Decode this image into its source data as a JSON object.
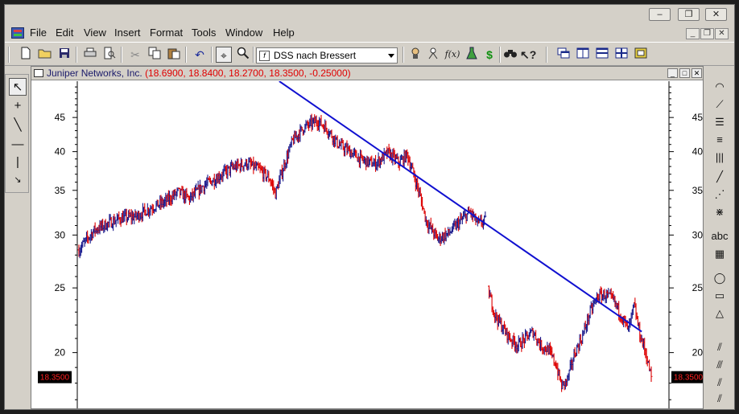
{
  "window": {
    "minimize_glyph": "–",
    "maximize_glyph": "❐",
    "close_glyph": "✕"
  },
  "menu": {
    "items": [
      "File",
      "Edit",
      "View",
      "Insert",
      "Format",
      "Tools",
      "Window",
      "Help"
    ],
    "mdi_minimize": "_",
    "mdi_restore": "❐",
    "mdi_close": "✕"
  },
  "toolbar": {
    "study_select_value": "DSS nach Bressert",
    "study_select_icon": "f",
    "study_dollar": "$",
    "study_fx": "f(x)",
    "icons": [
      "new-file-icon",
      "open-folder-icon",
      "save-icon",
      "print-icon",
      "print-preview-icon",
      "cut-icon",
      "copy-icon",
      "paste-icon",
      "undo-icon",
      "crosshair-icon",
      "zoom-icon"
    ]
  },
  "left_palette": {
    "icons": [
      "pointer-icon",
      "crosshair-icon",
      "trendline-icon",
      "horizontal-line-icon",
      "vertical-line-icon",
      "arrow-icon"
    ]
  },
  "right_palette": {
    "icons": [
      "speed-arc-icon",
      "speed-fan-icon",
      "fibonacci-retracement-icon",
      "fibonacci-time-icon",
      "cycle-lines-icon",
      "gann-line-icon",
      "gann-fan-icon",
      "gann-grid-icon",
      "text-label-icon",
      "table-icon",
      "ellipse-icon",
      "rectangle-icon",
      "triangle-icon",
      "andrews-pitchfork-icon",
      "parallel-lines-icon",
      "regression-channel-icon"
    ],
    "text_tool_label": "abc"
  },
  "chart_window": {
    "symbol": "Juniper Networks, Inc.",
    "ohlc": "(18.6900, 18.8400, 18.2700, 18.3500, -0.25000)",
    "minimize_glyph": "_",
    "restore_glyph": "□",
    "close_glyph": "✕"
  },
  "chart_data": {
    "type": "bar",
    "subtype": "ohlc-price-chart",
    "title": "Juniper Networks, Inc.",
    "scale": "log",
    "ylim": [
      16.5,
      51
    ],
    "y_ticks": [
      45,
      40,
      35,
      30,
      25,
      20
    ],
    "last_price_label": "18.3500",
    "last_price": 18.35,
    "grid": false,
    "colors": {
      "up_bar": "#1a1a8c",
      "down_bar": "#dd0000",
      "trendline": "#1010d0",
      "last_price_bg": "#000000",
      "last_price_text": "#ff2020"
    },
    "x_range": [
      0,
      300
    ],
    "trendline": {
      "x0": 105,
      "y0": 51,
      "x1": 295,
      "y1": 21.5
    },
    "price_path": [
      [
        0,
        28.5
      ],
      [
        8,
        30.5
      ],
      [
        15,
        31.2
      ],
      [
        22,
        31.8
      ],
      [
        30,
        32.0
      ],
      [
        38,
        33.0
      ],
      [
        45,
        33.6
      ],
      [
        52,
        34.8
      ],
      [
        58,
        34.0
      ],
      [
        65,
        35.5
      ],
      [
        72,
        36.5
      ],
      [
        80,
        37.8
      ],
      [
        88,
        38.4
      ],
      [
        95,
        37.5
      ],
      [
        100,
        36.4
      ],
      [
        103,
        34.6
      ],
      [
        108,
        38.5
      ],
      [
        112,
        41.5
      ],
      [
        118,
        43.5
      ],
      [
        125,
        44.5
      ],
      [
        130,
        43.3
      ],
      [
        136,
        41.0
      ],
      [
        142,
        40.0
      ],
      [
        148,
        38.9
      ],
      [
        155,
        38.3
      ],
      [
        162,
        39.8
      ],
      [
        168,
        38.5
      ],
      [
        172,
        39.6
      ],
      [
        178,
        35.0
      ],
      [
        182,
        31.5
      ],
      [
        188,
        29.6
      ],
      [
        194,
        30.2
      ],
      [
        200,
        31.5
      ],
      [
        205,
        32.5
      ],
      [
        209,
        31.2
      ],
      [
        213,
        31.5
      ],
      [
        215,
        24.5
      ],
      [
        218,
        22.8
      ],
      [
        222,
        21.8
      ],
      [
        226,
        21.0
      ],
      [
        230,
        20.5
      ],
      [
        234,
        21.0
      ],
      [
        238,
        21.5
      ],
      [
        242,
        20.5
      ],
      [
        246,
        20.2
      ],
      [
        250,
        19.2
      ],
      [
        253,
        17.8
      ],
      [
        256,
        18.2
      ],
      [
        260,
        20.0
      ],
      [
        264,
        21.2
      ],
      [
        268,
        23.0
      ],
      [
        272,
        24.3
      ],
      [
        276,
        24.4
      ],
      [
        280,
        24.0
      ],
      [
        284,
        22.8
      ],
      [
        288,
        21.6
      ],
      [
        291,
        23.5
      ],
      [
        294,
        21.3
      ],
      [
        297,
        20.0
      ],
      [
        300,
        18.35
      ]
    ]
  }
}
